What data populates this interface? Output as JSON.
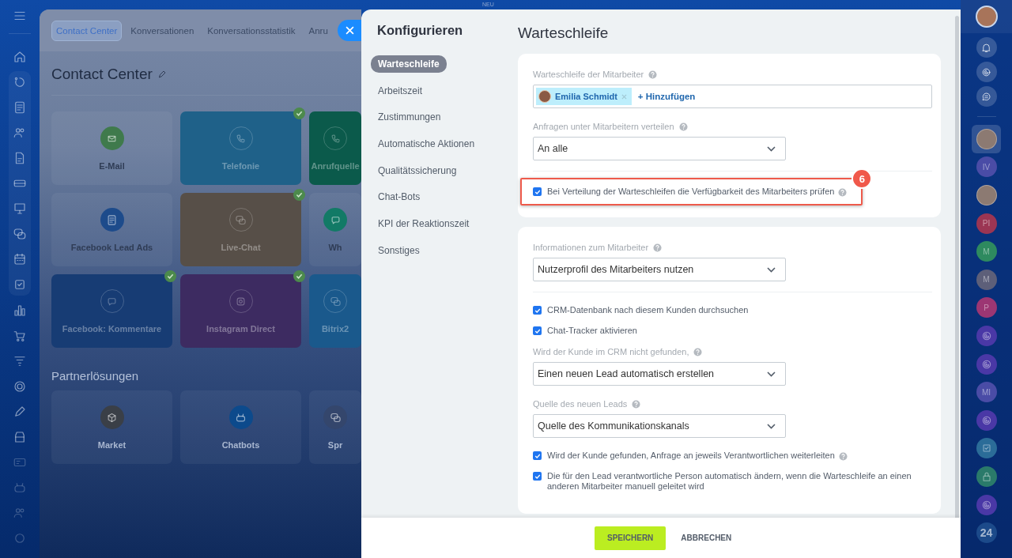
{
  "top_label": "NEU",
  "background_page": {
    "tabs": [
      {
        "label": "Contact Center",
        "selected": true
      },
      {
        "label": "Konversationen",
        "selected": false
      },
      {
        "label": "Konversationsstatistik",
        "selected": false
      },
      {
        "label": "Anru",
        "selected": false
      }
    ],
    "title": "Contact Center",
    "tiles": [
      {
        "label": "E-Mail",
        "kind": "plain",
        "color": "#3f7a4c",
        "connected": false
      },
      {
        "label": "Telefonie",
        "kind": "colored",
        "color": "#1f6189",
        "connected": true
      },
      {
        "label": "Anrufquelle",
        "kind": "colored",
        "color": "#0b5a4b",
        "connected": false
      },
      {
        "label": "Facebook Lead Ads",
        "kind": "plain",
        "color": "#1d4b8b",
        "connected": false
      },
      {
        "label": "Live-Chat",
        "kind": "colored",
        "color": "#574f48",
        "connected": true
      },
      {
        "label": "Wh",
        "kind": "plain",
        "color": "#127a66",
        "connected": false
      },
      {
        "label": "Facebook: Kommentare",
        "kind": "colored",
        "color": "#173c74",
        "connected": true
      },
      {
        "label": "Instagram Direct",
        "kind": "colored",
        "color": "#3d2b61",
        "connected": true
      },
      {
        "label": "Bitrix2",
        "kind": "colored",
        "color": "#1a598c",
        "connected": false
      }
    ],
    "partner_title": "Partnerlösungen",
    "partner_tiles": [
      {
        "label": "Market",
        "color": "#3a3f47"
      },
      {
        "label": "Chatbots",
        "color": "#0c4a8c"
      },
      {
        "label": "Spr",
        "color": "#34466c"
      }
    ]
  },
  "panel": {
    "nav_title": "Konfigurieren",
    "nav": [
      {
        "label": "Warteschleife",
        "selected": true
      },
      {
        "label": "Arbeitszeit",
        "selected": false
      },
      {
        "label": "Zustimmungen",
        "selected": false
      },
      {
        "label": "Automatische Aktionen",
        "selected": false
      },
      {
        "label": "Qualitätssicherung",
        "selected": false
      },
      {
        "label": "Chat-Bots",
        "selected": false
      },
      {
        "label": "KPI der Reaktionszeit",
        "selected": false
      },
      {
        "label": "Sonstiges",
        "selected": false
      }
    ],
    "title": "Warteschleife",
    "sections": [
      {
        "fields": [
          {
            "kind": "tags",
            "label": "Warteschleife der Mitarbeiter",
            "help": true,
            "tags": [
              {
                "name": "Emilia Schmidt"
              }
            ],
            "add_label": "+ Hinzufügen"
          },
          {
            "kind": "select",
            "label": "Anfragen unter Mitarbeitern verteilen",
            "help": true,
            "value": "An alle"
          },
          {
            "kind": "divider"
          },
          {
            "kind": "checkbox",
            "label": "Bei Verteilung der Warteschleifen die Verfügbarkeit des Mitarbeiters prüfen",
            "help": true,
            "checked": true,
            "annotation": "6"
          }
        ]
      },
      {
        "fields": [
          {
            "kind": "select",
            "label": "Informationen zum Mitarbeiter",
            "help": true,
            "value": "Nutzerprofil des Mitarbeiters nutzen"
          },
          {
            "kind": "divider"
          },
          {
            "kind": "checkbox",
            "label": "CRM-Datenbank nach diesem Kunden durchsuchen",
            "help": false,
            "checked": true
          },
          {
            "kind": "checkbox",
            "label": "Chat-Tracker aktivieren",
            "help": false,
            "checked": true
          },
          {
            "kind": "select",
            "label": "Wird der Kunde im CRM nicht gefunden,",
            "help": true,
            "value": "Einen neuen Lead automatisch erstellen"
          },
          {
            "kind": "select",
            "label": "Quelle des neuen Leads",
            "help": true,
            "value": "Quelle des Kommunikationskanals"
          },
          {
            "kind": "checkbox",
            "label": "Wird der Kunde gefunden, Anfrage an jeweils Verantwortlichen weiterleiten",
            "help": true,
            "checked": true
          },
          {
            "kind": "checkbox",
            "label": "Die für den Lead verantwortliche Person automatisch ändern, wenn die Warteschleife an einen anderen Mitarbeiter manuell geleitet wird",
            "help": false,
            "checked": true
          }
        ]
      }
    ],
    "footer": {
      "save": "SPEICHERN",
      "cancel": "ABBRECHEN"
    }
  },
  "right_rail": {
    "chats": [
      {
        "kind": "avatar",
        "selected": true
      },
      {
        "kind": "initials",
        "text": "IV",
        "color": "#4a4ca6",
        "selected": false
      },
      {
        "kind": "avatar",
        "selected": false
      },
      {
        "kind": "initials",
        "text": "PI",
        "color": "#9b3553",
        "selected": false
      },
      {
        "kind": "initials",
        "text": "M",
        "color": "#2e8a5f",
        "selected": false
      },
      {
        "kind": "initials",
        "text": "M",
        "color": "#5d5f79",
        "selected": false
      },
      {
        "kind": "initials",
        "text": "P",
        "color": "#9c3673",
        "selected": false
      },
      {
        "kind": "channel",
        "color": "#4a38a6",
        "selected": false
      },
      {
        "kind": "channel",
        "color": "#4a38a6",
        "selected": false
      },
      {
        "kind": "initials",
        "text": "MI",
        "color": "#4a4ca6",
        "selected": false
      },
      {
        "kind": "channel",
        "color": "#4a38a6",
        "selected": false
      },
      {
        "kind": "tasks",
        "color": "#2b6c98",
        "selected": false
      },
      {
        "kind": "lock",
        "color": "#2a7a6a",
        "selected": false
      },
      {
        "kind": "channel",
        "color": "#4a38a6",
        "selected": false
      },
      {
        "kind": "logo",
        "text": "24",
        "color": "#1c4a8a",
        "selected": false
      }
    ]
  }
}
